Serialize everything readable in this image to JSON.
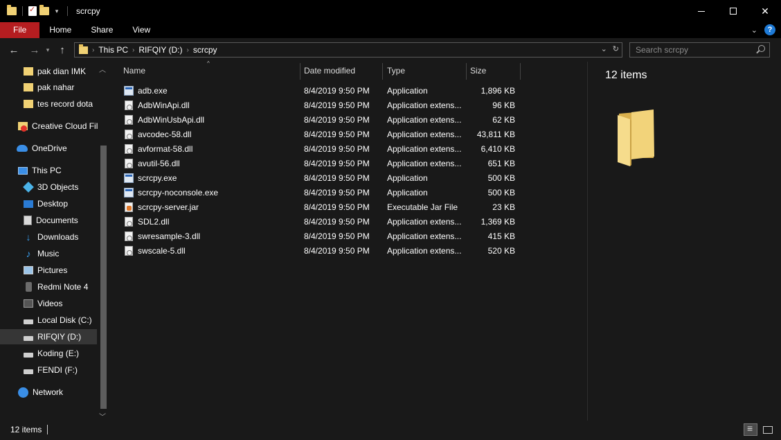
{
  "window": {
    "title": "scrcpy"
  },
  "ribbon": {
    "tabs": [
      "File",
      "Home",
      "Share",
      "View"
    ]
  },
  "address": {
    "crumbs": [
      "This PC",
      "RIFQIY (D:)",
      "scrcpy"
    ]
  },
  "search": {
    "placeholder": "Search scrcpy"
  },
  "sidebar": {
    "items": [
      {
        "label": "pak dian IMK",
        "icon": "folder-icon"
      },
      {
        "label": "pak nahar",
        "icon": "folder-icon"
      },
      {
        "label": "tes record dota",
        "icon": "folder-icon"
      },
      {
        "label": "Creative Cloud Fil",
        "icon": "creative-cloud-icon"
      },
      {
        "label": "OneDrive",
        "icon": "onedrive-cloud-icon"
      },
      {
        "label": "This PC",
        "icon": "computer-icon"
      },
      {
        "label": "3D Objects",
        "icon": "3d-objects-icon"
      },
      {
        "label": "Desktop",
        "icon": "desktop-icon"
      },
      {
        "label": "Documents",
        "icon": "documents-icon"
      },
      {
        "label": "Downloads",
        "icon": "download-icon"
      },
      {
        "label": "Music",
        "icon": "music-icon"
      },
      {
        "label": "Pictures",
        "icon": "pictures-icon"
      },
      {
        "label": "Redmi Note 4",
        "icon": "phone-icon"
      },
      {
        "label": "Videos",
        "icon": "videos-icon"
      },
      {
        "label": "Local Disk (C:)",
        "icon": "drive-icon"
      },
      {
        "label": "RIFQIY (D:)",
        "icon": "drive-icon"
      },
      {
        "label": "Koding (E:)",
        "icon": "drive-icon"
      },
      {
        "label": "FENDI (F:)",
        "icon": "drive-icon"
      },
      {
        "label": "Network",
        "icon": "network-icon"
      }
    ]
  },
  "filelist": {
    "columns": [
      "Name",
      "Date modified",
      "Type",
      "Size"
    ],
    "rows": [
      {
        "name": "adb.exe",
        "date": "8/4/2019 9:50 PM",
        "type": "Application",
        "size": "1,896 KB",
        "icon": "exe-icon"
      },
      {
        "name": "AdbWinApi.dll",
        "date": "8/4/2019 9:50 PM",
        "type": "Application extens...",
        "size": "96 KB",
        "icon": "dll-icon"
      },
      {
        "name": "AdbWinUsbApi.dll",
        "date": "8/4/2019 9:50 PM",
        "type": "Application extens...",
        "size": "62 KB",
        "icon": "dll-icon"
      },
      {
        "name": "avcodec-58.dll",
        "date": "8/4/2019 9:50 PM",
        "type": "Application extens...",
        "size": "43,811 KB",
        "icon": "dll-icon"
      },
      {
        "name": "avformat-58.dll",
        "date": "8/4/2019 9:50 PM",
        "type": "Application extens...",
        "size": "6,410 KB",
        "icon": "dll-icon"
      },
      {
        "name": "avutil-56.dll",
        "date": "8/4/2019 9:50 PM",
        "type": "Application extens...",
        "size": "651 KB",
        "icon": "dll-icon"
      },
      {
        "name": "scrcpy.exe",
        "date": "8/4/2019 9:50 PM",
        "type": "Application",
        "size": "500 KB",
        "icon": "exe-icon"
      },
      {
        "name": "scrcpy-noconsole.exe",
        "date": "8/4/2019 9:50 PM",
        "type": "Application",
        "size": "500 KB",
        "icon": "exe-icon"
      },
      {
        "name": "scrcpy-server.jar",
        "date": "8/4/2019 9:50 PM",
        "type": "Executable Jar File",
        "size": "23 KB",
        "icon": "jar-icon"
      },
      {
        "name": "SDL2.dll",
        "date": "8/4/2019 9:50 PM",
        "type": "Application extens...",
        "size": "1,369 KB",
        "icon": "dll-icon"
      },
      {
        "name": "swresample-3.dll",
        "date": "8/4/2019 9:50 PM",
        "type": "Application extens...",
        "size": "415 KB",
        "icon": "dll-icon"
      },
      {
        "name": "swscale-5.dll",
        "date": "8/4/2019 9:50 PM",
        "type": "Application extens...",
        "size": "520 KB",
        "icon": "dll-icon"
      }
    ]
  },
  "details_pane": {
    "count": "12 items"
  },
  "statusbar": {
    "text": "12 items"
  },
  "colors": {
    "file_tab": "#b51d20",
    "background": "#191919",
    "folder": "#f0d174",
    "selected": "#363636"
  }
}
